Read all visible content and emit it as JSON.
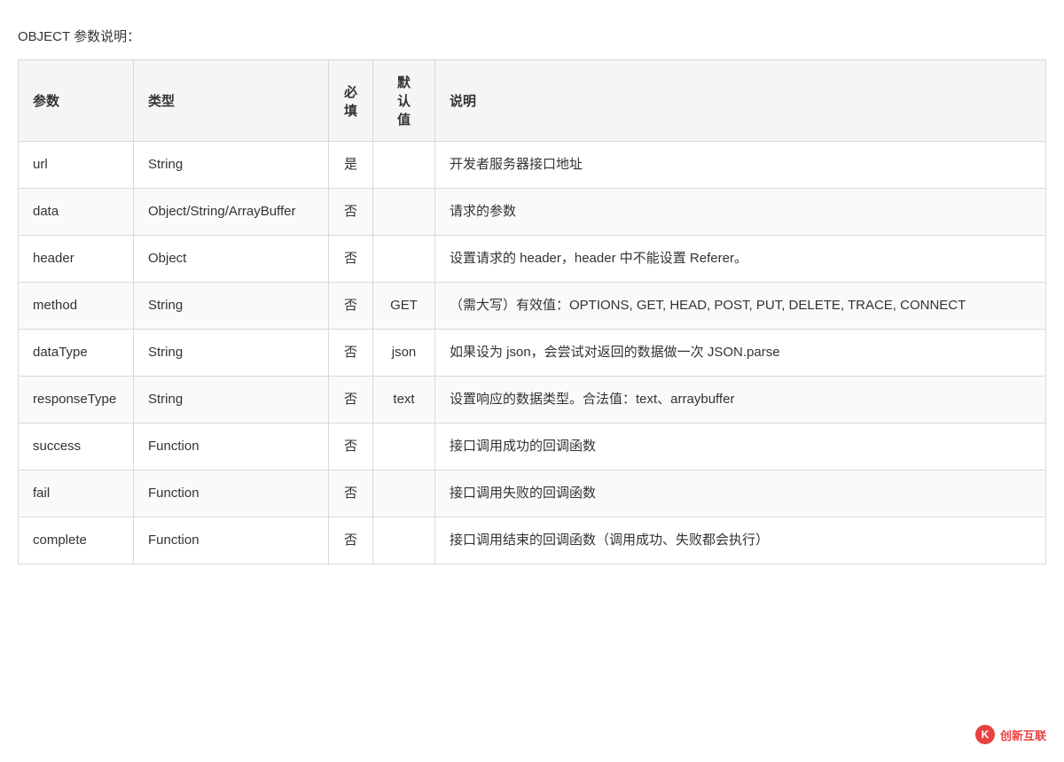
{
  "page": {
    "title": "OBJECT 参数说明："
  },
  "table": {
    "headers": {
      "param": "参数",
      "type": "类型",
      "required": "必\n填",
      "default": "默\n认\n值",
      "description": "说明"
    },
    "rows": [
      {
        "param": "url",
        "type": "String",
        "required": "是",
        "default": "",
        "description": "开发者服务器接口地址"
      },
      {
        "param": "data",
        "type": "Object/String/ArrayBuffer",
        "required": "否",
        "default": "",
        "description": "请求的参数"
      },
      {
        "param": "header",
        "type": "Object",
        "required": "否",
        "default": "",
        "description": "设置请求的 header，header 中不能设置 Referer。"
      },
      {
        "param": "method",
        "type": "String",
        "required": "否",
        "default": "GET",
        "description": "（需大写）有效值：OPTIONS, GET, HEAD, POST, PUT, DELETE, TRACE, CONNECT"
      },
      {
        "param": "dataType",
        "type": "String",
        "required": "否",
        "default": "json",
        "description": "如果设为 json，会尝试对返回的数据做一次 JSON.parse"
      },
      {
        "param": "responseType",
        "type": "String",
        "required": "否",
        "default": "text",
        "description": "设置响应的数据类型。合法值：text、arraybuffer"
      },
      {
        "param": "success",
        "type": "Function",
        "required": "否",
        "default": "",
        "description": "接口调用成功的回调函数"
      },
      {
        "param": "fail",
        "type": "Function",
        "required": "否",
        "default": "",
        "description": "接口调用失败的回调函数"
      },
      {
        "param": "complete",
        "type": "Function",
        "required": "否",
        "default": "",
        "description": "接口调用结束的回调函数（调用成功、失败都会执行）"
      }
    ]
  },
  "watermark": {
    "label": "创新互联",
    "icon_char": "K"
  }
}
